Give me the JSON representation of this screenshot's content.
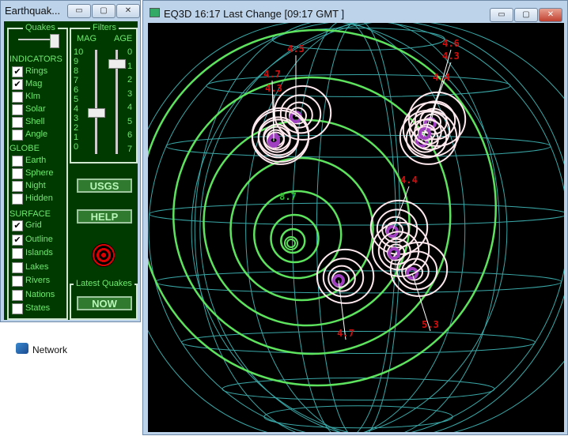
{
  "control_window": {
    "title": "Earthquak...",
    "minimize": "▭",
    "maximize": "▢",
    "close": "✕",
    "quakes_group": "Quakes",
    "indicators_heading": "INDICATORS",
    "indicators": [
      {
        "label": "Rings",
        "checked": true
      },
      {
        "label": "Mag",
        "checked": true
      },
      {
        "label": "Klm",
        "checked": false
      },
      {
        "label": "Solar",
        "checked": false
      },
      {
        "label": "Shell",
        "checked": false
      },
      {
        "label": "Angle",
        "checked": false
      }
    ],
    "globe_heading": "GLOBE",
    "globe": [
      {
        "label": "Earth",
        "checked": false
      },
      {
        "label": "Sphere",
        "checked": false
      },
      {
        "label": "Night",
        "checked": false
      },
      {
        "label": "Hidden",
        "checked": false
      }
    ],
    "surface_heading": "SURFACE",
    "surface": [
      {
        "label": "Grid",
        "checked": true
      },
      {
        "label": "Outline",
        "checked": true
      },
      {
        "label": "Islands",
        "checked": false
      },
      {
        "label": "Lakes",
        "checked": false
      },
      {
        "label": "Rivers",
        "checked": false
      },
      {
        "label": "Nations",
        "checked": false
      },
      {
        "label": "States",
        "checked": false
      }
    ],
    "filters_group": "Filters",
    "mag_label": "MAG",
    "age_label": "AGE",
    "mag_ticks": [
      "10",
      "9",
      "8",
      "7",
      "6",
      "5",
      "4",
      "3",
      "2",
      "1",
      "0"
    ],
    "age_ticks": [
      "0",
      "1",
      "2",
      "3",
      "4",
      "5",
      "6",
      "7"
    ],
    "mag_value": 4,
    "age_value": 1,
    "usgs_button": "USGS",
    "help_button": "HELP",
    "latest_group": "Latest Quakes",
    "now_button": "NOW"
  },
  "desktop": {
    "network_label": "Network"
  },
  "viewer": {
    "title": "EQ3D  16:17 Last Change  [09:17 GMT ]",
    "colors": {
      "grid": "#3aa7a7",
      "rings_major": "#5ee35e",
      "rings_minor": "#ffe8ee",
      "label": "#d01010",
      "label_major": "#30c030",
      "epicenter": "#a040c0"
    },
    "quake_labels": [
      "4.5",
      "4.7",
      "4.3",
      "4.6",
      "4.3",
      "4.4",
      "8.7",
      "4.4",
      "4.7",
      "5.3"
    ]
  }
}
